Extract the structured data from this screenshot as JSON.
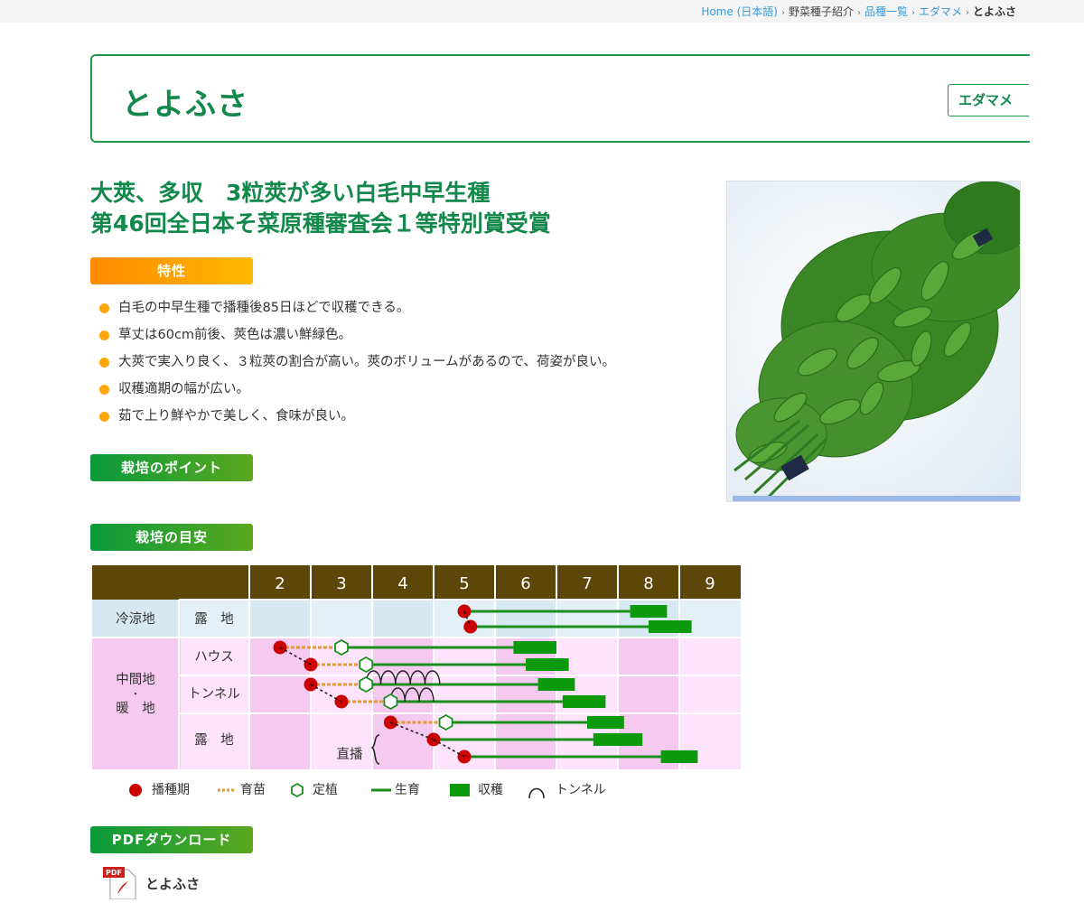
{
  "breadcrumb": {
    "home": "Home (日本語)",
    "intro": "野菜種子紹介",
    "list": "品種一覧",
    "category": "エダマメ",
    "current": "とよふさ"
  },
  "title": "とよふさ",
  "category_button": "エダマメ",
  "headline": [
    "大莢、多収　3粒莢が多い白毛中早生種",
    "第46回全日本そ菜原種審査会１等特別賞受賞"
  ],
  "sections": {
    "features": "特性",
    "cultivation_points": "栽培のポイント",
    "cultivation_guide": "栽培の目安",
    "pdf_download": "PDFダウンロード"
  },
  "features": [
    "白毛の中早生種で播種後85日ほどで収穫できる。",
    "草丈は60cm前後、莢色は濃い鮮緑色。",
    "大莢で実入り良く、３粒莢の割合が高い。莢のボリュームがあるので、荷姿が良い。",
    "収穫適期の幅が広い。",
    "茹で上り鮮やかで美しく、食味が良い。"
  ],
  "chart_data": {
    "type": "table",
    "months": [
      "2",
      "3",
      "4",
      "5",
      "6",
      "7",
      "8",
      "9"
    ],
    "regions": [
      {
        "name": "冷涼地",
        "rows": [
          {
            "method": "露　地"
          }
        ]
      },
      {
        "name": "中間地・暖　地",
        "name_lines": [
          "中間地",
          "・",
          "暖　地"
        ],
        "rows": [
          {
            "method": "ハウス"
          },
          {
            "method": "トンネル"
          },
          {
            "method": "露　地",
            "note": "直播"
          }
        ]
      }
    ],
    "schedules": [
      {
        "row": "冷涼地-露地",
        "sow": 5.0,
        "grow_end": 7.7,
        "harvest": [
          7.7,
          8.3
        ]
      },
      {
        "row": "冷涼地-露地",
        "sow": 5.1,
        "grow_end": 8.0,
        "harvest": [
          8.0,
          8.7
        ]
      },
      {
        "row": "中間地-ハウス",
        "sow": 2.0,
        "nursery_end": 3.0,
        "transplant": 3.0,
        "grow_end": 5.8,
        "harvest": [
          5.8,
          6.5
        ]
      },
      {
        "row": "中間地-ハウス",
        "sow": 2.5,
        "nursery_end": 3.4,
        "transplant": 3.4,
        "grow_end": 6.0,
        "harvest": [
          6.0,
          6.7
        ]
      },
      {
        "row": "中間地-トンネル",
        "sow": 2.5,
        "nursery_end": 3.4,
        "transplant": 3.4,
        "grow_end": 6.2,
        "harvest": [
          6.2,
          6.8
        ],
        "tunnel": [
          3.4,
          4.6
        ]
      },
      {
        "row": "中間地-トンネル",
        "sow": 3.0,
        "nursery_end": 3.8,
        "transplant": 3.8,
        "grow_end": 6.6,
        "harvest": [
          6.6,
          7.3
        ],
        "tunnel": [
          3.8,
          4.5
        ]
      },
      {
        "row": "中間地-露地",
        "sow": 3.8,
        "nursery_end": 4.7,
        "transplant": 4.7,
        "grow_end": 7.0,
        "harvest": [
          7.0,
          7.6
        ]
      },
      {
        "row": "中間地-露地",
        "sow": 4.5,
        "grow_end": 7.1,
        "harvest": [
          7.1,
          7.9
        ]
      },
      {
        "row": "中間地-露地",
        "sow": 5.0,
        "grow_end": 8.2,
        "harvest": [
          8.2,
          8.8
        ]
      }
    ],
    "legend": [
      "播種期",
      "育苗",
      "定植",
      "生育",
      "収穫",
      "トンネル"
    ],
    "colors": {
      "header": "#5c4708",
      "cool": "#d6e9f3",
      "warm": "#f6c9f0",
      "sow": "#cc0000",
      "nursery": "#dd9d34",
      "grow": "#1b8f1b",
      "harvest": "#0c9a0c"
    }
  },
  "pdf": {
    "icon_label": "PDF",
    "file_label": "とよふさ"
  }
}
